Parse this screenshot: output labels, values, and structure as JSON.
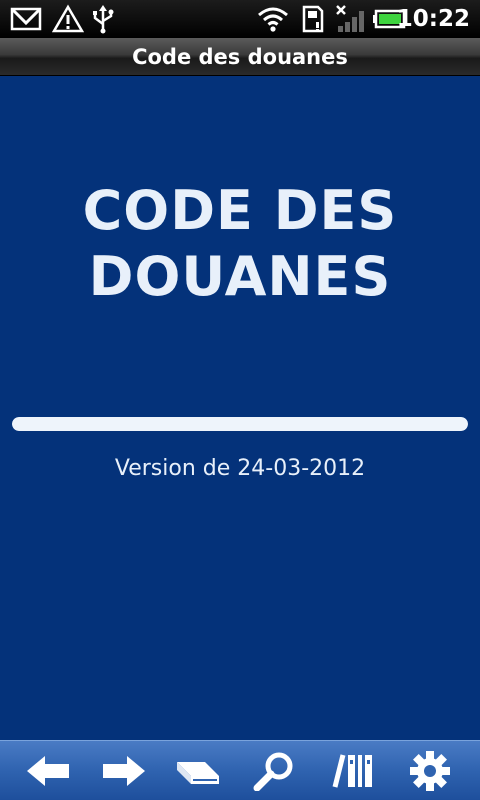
{
  "status_bar": {
    "time": "10:22",
    "icons": [
      "gmail-icon",
      "warning-icon",
      "usb-icon",
      "wifi-icon",
      "sd-card-icon",
      "no-signal-icon",
      "battery-icon"
    ]
  },
  "title_bar": {
    "title": "Code des douanes"
  },
  "main": {
    "book_title": "CODE DES\nDOUANES",
    "progress": 1.0,
    "version_text": "Version de 24-03-2012"
  },
  "toolbar": {
    "buttons": [
      "back-arrow-icon",
      "forward-arrow-icon",
      "bookmarks-icon",
      "search-icon",
      "library-icon",
      "settings-gear-icon"
    ]
  },
  "colors": {
    "background": "#04327a",
    "text": "#e8f0fa",
    "toolbar": "#2f63b0"
  }
}
